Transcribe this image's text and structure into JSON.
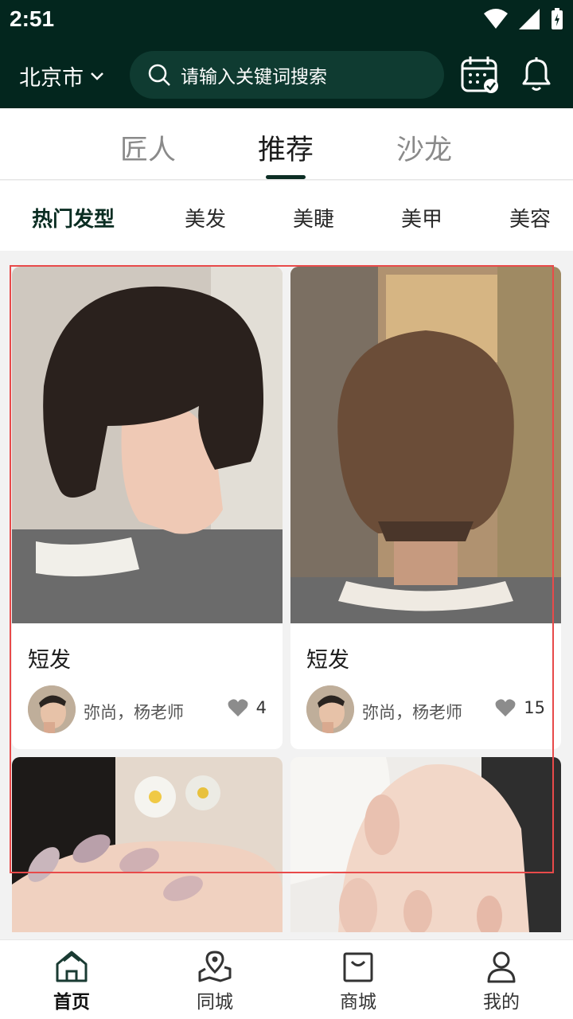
{
  "status": {
    "time": "2:51"
  },
  "header": {
    "city": "北京市",
    "search_placeholder": "请输入关键词搜索"
  },
  "top_tabs": [
    {
      "label": "匠人",
      "active": false
    },
    {
      "label": "推荐",
      "active": true
    },
    {
      "label": "沙龙",
      "active": false
    }
  ],
  "category_tabs": [
    {
      "label": "热门发型",
      "active": true
    },
    {
      "label": "美发",
      "active": false
    },
    {
      "label": "美睫",
      "active": false
    },
    {
      "label": "美甲",
      "active": false
    },
    {
      "label": "美容",
      "active": false
    }
  ],
  "cards": [
    {
      "title": "短发",
      "author": "弥尚，杨老师",
      "likes": "4"
    },
    {
      "title": "短发",
      "author": "弥尚，杨老师",
      "likes": "15"
    }
  ],
  "bottom_nav": [
    {
      "label": "首页",
      "icon": "home-icon",
      "active": true
    },
    {
      "label": "同城",
      "icon": "location-map-icon",
      "active": false
    },
    {
      "label": "商城",
      "icon": "shopping-bag-icon",
      "active": false
    },
    {
      "label": "我的",
      "icon": "user-icon",
      "active": false
    }
  ],
  "colors": {
    "header_bg": "#03261e",
    "accent": "#0c2e24",
    "highlight": "#e84a4a"
  }
}
